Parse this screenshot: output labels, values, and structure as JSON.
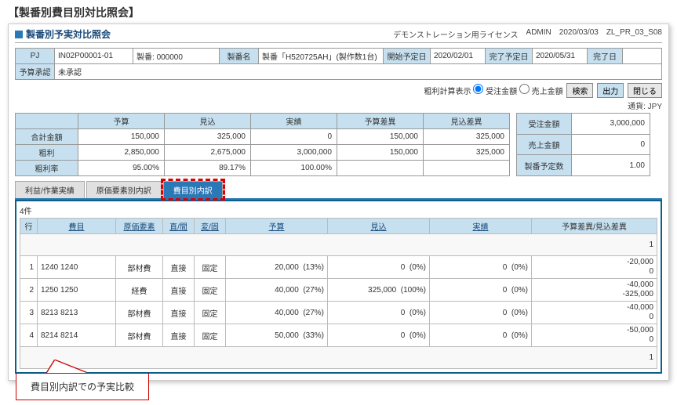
{
  "pageTitle": "【製番別費目別対比照会】",
  "header": {
    "screenName": "製番別予実対比照会",
    "license": "デモンストレーション用ライセンス",
    "user": "ADMIN",
    "date": "2020/03/03",
    "screenId": "ZL_PR_03_S08"
  },
  "info": {
    "pjLabel": "PJ",
    "pjCode": "IN02P00001-01",
    "seibanLabel": "製番:",
    "seiban": "000000",
    "seibanNameLabel": "製番名",
    "seibanName": "製番「H520725AH」(製作数1台)",
    "startLabel": "開始予定日",
    "start": "2020/02/01",
    "endLabel": "完了予定日",
    "end": "2020/05/31",
    "doneLabel": "完了日",
    "done": "",
    "approvalLabel": "予算承認",
    "approval": "未承認"
  },
  "options": {
    "label": "粗利計算表示",
    "opt1": "受注金額",
    "opt2": "売上金額",
    "btnSearch": "検索",
    "btnOutput": "出力",
    "btnClose": "閉じる"
  },
  "currency": "通貨: JPY",
  "summary": {
    "cols": [
      "予算",
      "見込",
      "実績",
      "予算差異",
      "見込差異"
    ],
    "rows": [
      {
        "label": "合計金額",
        "vals": [
          "150,000",
          "325,000",
          "0",
          "150,000",
          "325,000"
        ]
      },
      {
        "label": "粗利",
        "vals": [
          "2,850,000",
          "2,675,000",
          "3,000,000",
          "150,000",
          "325,000"
        ]
      },
      {
        "label": "粗利率",
        "vals": [
          "95.00%",
          "89.17%",
          "100.00%",
          "",
          ""
        ]
      }
    ],
    "side": [
      {
        "label": "受注金額",
        "val": "3,000,000"
      },
      {
        "label": "売上金額",
        "val": "0"
      },
      {
        "label": "製番予定数",
        "val": "1.00"
      }
    ]
  },
  "tabs": [
    "利益/作業実績",
    "原価要素別内訳",
    "費目別内訳"
  ],
  "detail": {
    "count": "4件",
    "headers": [
      "行",
      "費目",
      "原価要素",
      "直/間",
      "変/固",
      "予算",
      "見込",
      "実績",
      "予算差異/見込差異"
    ],
    "rows": [
      {
        "no": "1",
        "himoku": "1240 1240",
        "elem": "部材費",
        "dc": "直接",
        "vf": "固定",
        "budget": "20,000",
        "budgetPct": "(13%)",
        "forecast": "0",
        "forecastPct": "(0%)",
        "actual": "0",
        "actualPct": "(0%)",
        "diff1": "-20,000",
        "diff2": "0"
      },
      {
        "no": "2",
        "himoku": "1250 1250",
        "elem": "経費",
        "dc": "直接",
        "vf": "固定",
        "budget": "40,000",
        "budgetPct": "(27%)",
        "forecast": "325,000",
        "forecastPct": "(100%)",
        "actual": "0",
        "actualPct": "(0%)",
        "diff1": "-40,000",
        "diff2": "-325,000"
      },
      {
        "no": "3",
        "himoku": "8213 8213",
        "elem": "部材費",
        "dc": "直接",
        "vf": "固定",
        "budget": "40,000",
        "budgetPct": "(27%)",
        "forecast": "0",
        "forecastPct": "(0%)",
        "actual": "0",
        "actualPct": "(0%)",
        "diff1": "-40,000",
        "diff2": "0"
      },
      {
        "no": "4",
        "himoku": "8214 8214",
        "elem": "部材費",
        "dc": "直接",
        "vf": "固定",
        "budget": "50,000",
        "budgetPct": "(33%)",
        "forecast": "0",
        "forecastPct": "(0%)",
        "actual": "0",
        "actualPct": "(0%)",
        "diff1": "-50,000",
        "diff2": "0"
      }
    ],
    "topTotal": "1",
    "bottomTotal": "1"
  },
  "callout": "費目別内訳での予実比較"
}
